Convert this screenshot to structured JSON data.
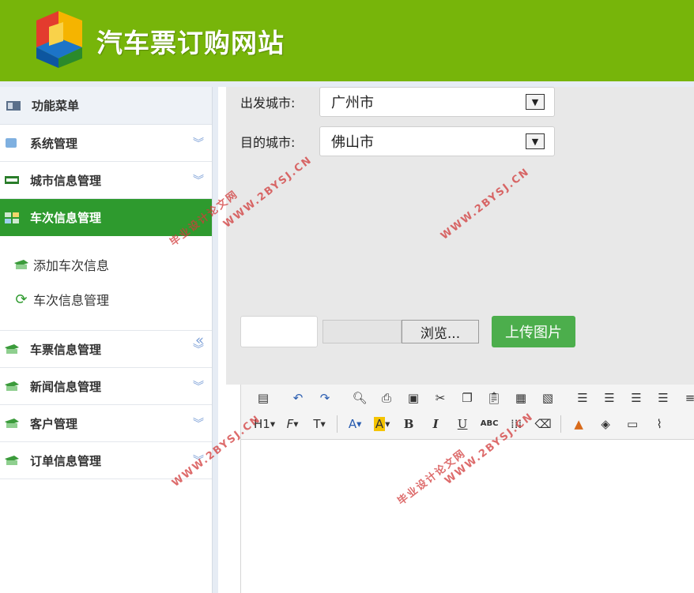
{
  "header": {
    "title": "汽车票订购网站"
  },
  "sidebar": {
    "menu_title": "功能菜单",
    "collapse_icon": "double-chevron-left-icon",
    "items": [
      {
        "label": "系统管理",
        "icon": "system-icon"
      },
      {
        "label": "城市信息管理",
        "icon": "city-icon"
      },
      {
        "label": "车次信息管理",
        "icon": "train-icon",
        "active": true
      },
      {
        "label": "车票信息管理",
        "icon": "ticket-icon"
      },
      {
        "label": "新闻信息管理",
        "icon": "news-icon"
      },
      {
        "label": "客户管理",
        "icon": "customer-icon"
      },
      {
        "label": "订单信息管理",
        "icon": "order-icon"
      }
    ],
    "submenu": [
      {
        "label": "添加车次信息",
        "icon": "add-icon"
      },
      {
        "label": "车次信息管理",
        "icon": "refresh-icon"
      }
    ]
  },
  "form": {
    "departure_label": "出发城市:",
    "departure_value": "广州市",
    "destination_label": "目的城市:",
    "destination_value": "佛山市",
    "browse_label": "浏览...",
    "upload_label": "上传图片"
  },
  "editor": {
    "heading_label": "H1",
    "font_family_label": "F",
    "font_size_label": "T",
    "font_color_label": "A",
    "highlight_label": "A",
    "bold_label": "B",
    "italic_label": "I",
    "underline_label": "U",
    "strike_label": "ABC"
  },
  "watermarks": [
    "WWW.2BYSJ.CN",
    "毕业设计论文网"
  ],
  "colors": {
    "header_bg": "#77b50a",
    "active_menu_bg": "#2e9a2e",
    "upload_btn_bg": "#4cae4c",
    "watermark": "#d23a3a"
  }
}
